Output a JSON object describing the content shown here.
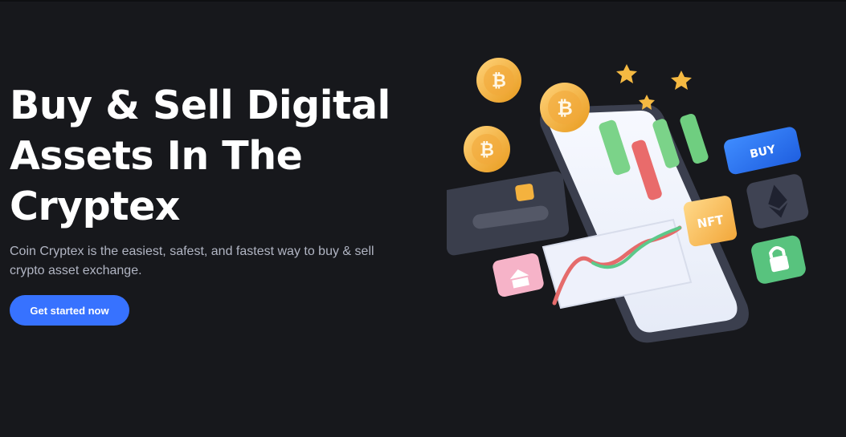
{
  "hero": {
    "title_lines": [
      "Buy & Sell Digital",
      "Assets In The",
      "Cryptex"
    ],
    "subtitle": "Coin Cryptex is the easiest, safest, and fastest way to buy & sell crypto asset exchange.",
    "cta_label": "Get started now"
  },
  "illustration": {
    "buy_badge": "BUY",
    "nft_badge": "NFT",
    "coin_symbol": "₿"
  },
  "colors": {
    "background": "#17181c",
    "accent": "#3772ff",
    "title": "#ffffff",
    "subtitle": "#b1b5c3"
  }
}
